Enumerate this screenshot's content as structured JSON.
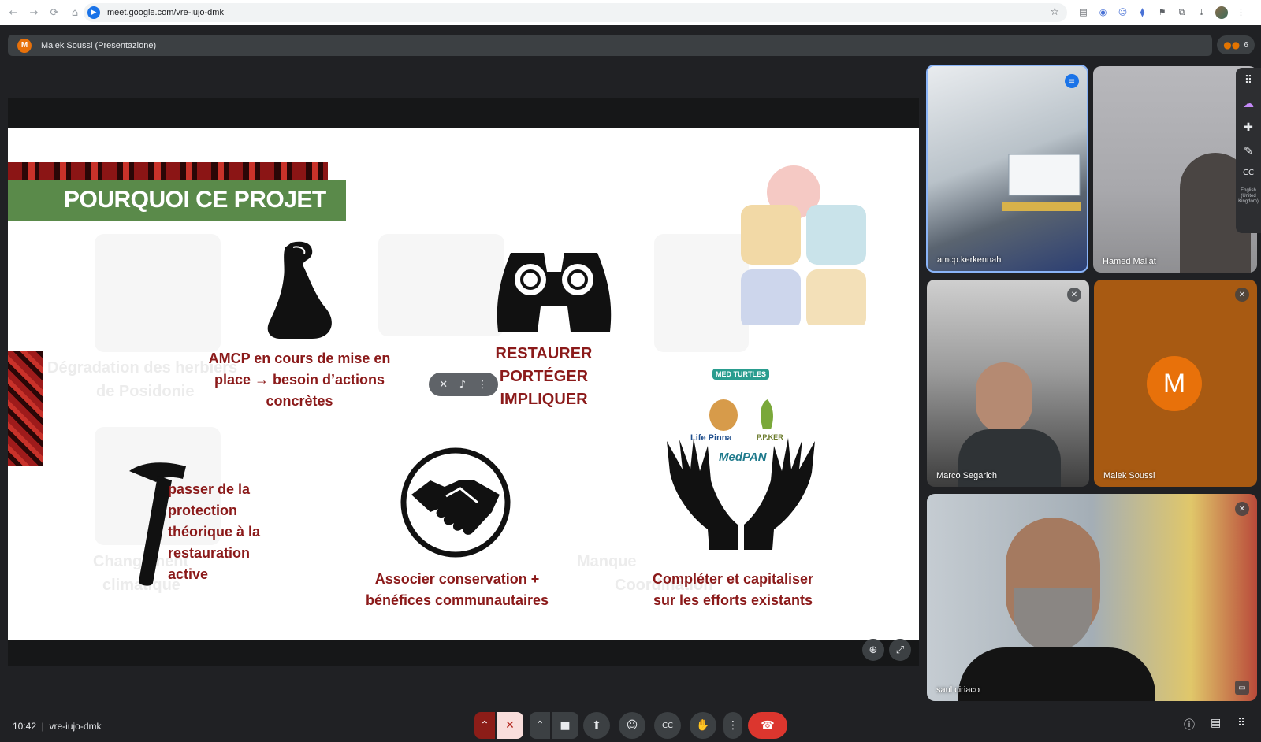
{
  "browser": {
    "url": "meet.google.com/vre-iujo-dmk",
    "nav": {
      "back": "←",
      "forward": "→",
      "reload": "⟳",
      "home": "⌂"
    },
    "star": "☆",
    "extensions": [
      "▤",
      "◉",
      "☺",
      "⧫",
      "⚑",
      "⧉",
      "⤓"
    ]
  },
  "meet": {
    "presentation_title": "Malek Soussi (Presentazione)",
    "presenter_initial": "M",
    "participants_count": "6",
    "meeting_code": "vre-iujo-dmk",
    "time": "10:42",
    "separator": "|"
  },
  "slide": {
    "title": "POURQUOI CE PROJET",
    "items": [
      {
        "icon": "flexed-arm-icon",
        "text_lines": [
          "AMCP en cours de mise en",
          "place → besoin d’actions",
          "concrètes"
        ]
      },
      {
        "icon": "binoculars-icon",
        "text_lines": [
          "RESTAURER",
          "PORTÉGER",
          "IMPLIQUER"
        ]
      },
      {
        "icon": "hammer-icon",
        "text_lines": [
          "passer de la",
          "protection",
          "théorique à la",
          "restauration",
          "active"
        ]
      },
      {
        "icon": "handshake-icon",
        "text_lines": [
          "Associer conservation +",
          "bénéfices communautaires"
        ]
      },
      {
        "icon": "hands-logos-icon",
        "text_lines": [
          "Compléter et capitaliser",
          "sur les efforts existants"
        ]
      }
    ],
    "ghost_text": [
      "Dégradation des herbiers",
      "de Posidonie",
      "Changement",
      "climatique",
      "Manque",
      "Coordination"
    ],
    "partner_logos": [
      "MED TURTLES",
      "Life Pinna",
      "P.P.KER",
      "MedPAN"
    ]
  },
  "participants": [
    {
      "name": "amcp.kerkennah",
      "speaking": true,
      "muted": false
    },
    {
      "name": "Hamed Mallat",
      "speaking": false,
      "muted": false
    },
    {
      "name": "Marco Segarich",
      "speaking": false,
      "muted": true
    },
    {
      "name": "Malek Soussi",
      "speaking": false,
      "muted": true,
      "initial": "M"
    },
    {
      "name": "saul ciriaco",
      "speaking": false,
      "muted": true
    }
  ],
  "side_tools": {
    "caption_language": "English (United Kingdom)"
  },
  "colors": {
    "background": "#202124",
    "slide_title_bg": "#5a8a4a",
    "slide_text": "#8b1a1a",
    "end_call": "#dc362e",
    "avatar_orange": "#e8710a",
    "active_speaker_border": "#8ab4f8"
  }
}
